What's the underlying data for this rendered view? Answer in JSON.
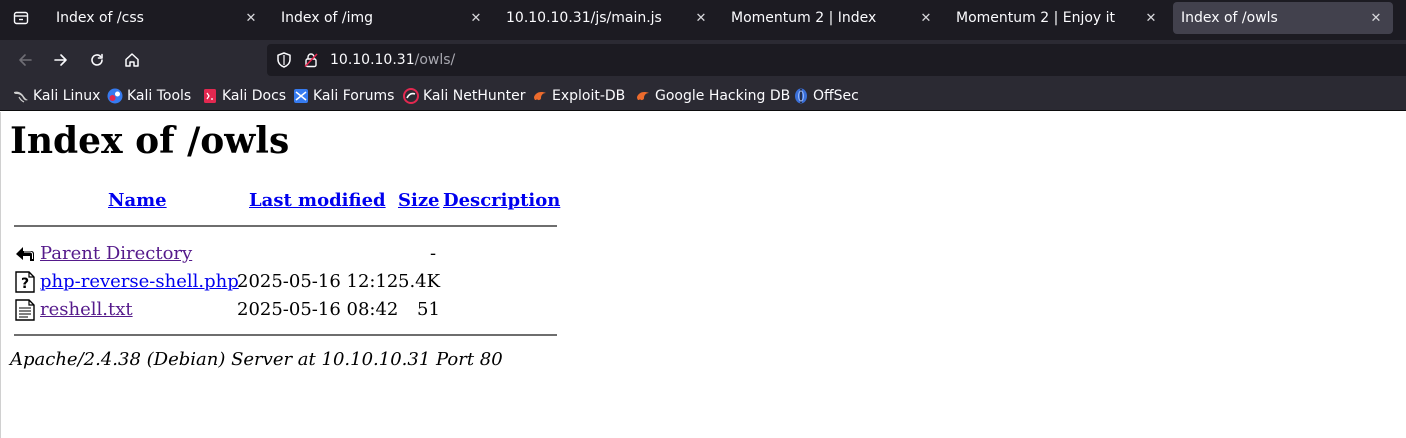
{
  "browser": {
    "tabs": [
      {
        "title": "Index of /css",
        "active": false
      },
      {
        "title": "Index of /img",
        "active": false
      },
      {
        "title": "10.10.10.31/js/main.js",
        "active": false
      },
      {
        "title": "Momentum 2 | Index",
        "active": false
      },
      {
        "title": "Momentum 2 | Enjoy it",
        "active": false
      },
      {
        "title": "Index of /owls",
        "active": true
      }
    ],
    "url": {
      "host": "10.10.10.31",
      "path": "/owls/"
    },
    "bookmarks": [
      {
        "label": "Kali Linux",
        "icon": "kali-dragon-icon"
      },
      {
        "label": "Kali Tools",
        "icon": "kali-tools-icon"
      },
      {
        "label": "Kali Docs",
        "icon": "kali-docs-icon"
      },
      {
        "label": "Kali Forums",
        "icon": "kali-forums-icon"
      },
      {
        "label": "Kali NetHunter",
        "icon": "nethunter-icon"
      },
      {
        "label": "Exploit-DB",
        "icon": "exploit-db-icon"
      },
      {
        "label": "Google Hacking DB",
        "icon": "ghdb-icon"
      },
      {
        "label": "OffSec",
        "icon": "offsec-icon"
      }
    ]
  },
  "page": {
    "title": "Index of /owls",
    "columns": {
      "name": "Name",
      "modified": "Last modified",
      "size": "Size",
      "description": "Description"
    },
    "rows": [
      {
        "name": "Parent Directory",
        "modified": "",
        "size": "-",
        "icon": "back-folder-icon",
        "visited": true
      },
      {
        "name": "php-reverse-shell.php",
        "modified": "2025-05-16 12:12",
        "size": "5.4K",
        "icon": "unknown-file-icon",
        "visited": false
      },
      {
        "name": "reshell.txt",
        "modified": "2025-05-16 08:42",
        "size": "51",
        "icon": "text-file-icon",
        "visited": true
      }
    ],
    "address": "Apache/2.4.38 (Debian) Server at 10.10.10.31 Port 80"
  }
}
